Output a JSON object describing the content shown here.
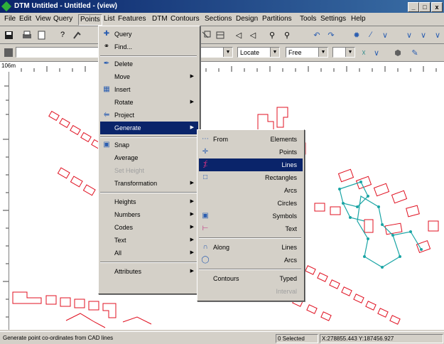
{
  "window": {
    "title": "DTM Untitled - Untitled - (view)",
    "minimize": "_",
    "maximize": "□",
    "close": "x"
  },
  "menubar": [
    "File",
    "Edit",
    "View",
    "Query",
    "Points",
    "List",
    "Features",
    "DTM",
    "Contours",
    "Sections",
    "Design",
    "Partitions",
    "Tools",
    "Settings",
    "Help"
  ],
  "toolbar2": {
    "layer_combo": "",
    "scale_combo": "Locate",
    "mode_combo": "Free"
  },
  "ruler": {
    "scale_label": "106m"
  },
  "points_menu": {
    "items": [
      {
        "label": "Query",
        "icon": "query-icon"
      },
      {
        "label": "Find...",
        "icon": "binoculars-icon"
      },
      {
        "label": "Delete",
        "icon": "delete-icon"
      },
      {
        "label": "Move",
        "submenu": true
      },
      {
        "label": "Insert",
        "icon": "insert-icon"
      },
      {
        "label": "Rotate",
        "submenu": true
      },
      {
        "label": "Project",
        "icon": "project-icon"
      },
      {
        "label": "Generate",
        "submenu": true,
        "highlighted": true
      },
      {
        "label": "Snap",
        "icon": "snap-icon"
      },
      {
        "label": "Average"
      },
      {
        "label": "Set Height",
        "disabled": true
      },
      {
        "label": "Transformation",
        "submenu": true
      },
      {
        "label": "Heights",
        "submenu": true
      },
      {
        "label": "Numbers",
        "submenu": true
      },
      {
        "label": "Codes",
        "submenu": true
      },
      {
        "label": "Text",
        "submenu": true
      },
      {
        "label": "All",
        "submenu": true
      },
      {
        "label": "Attributes",
        "submenu": true
      }
    ]
  },
  "generate_menu": {
    "items": [
      {
        "left": "From",
        "right": "Elements"
      },
      {
        "left": "",
        "right": "Points"
      },
      {
        "left": "",
        "right": "Lines",
        "highlighted": true
      },
      {
        "left": "",
        "right": "Rectangles"
      },
      {
        "left": "",
        "right": "Arcs"
      },
      {
        "left": "",
        "right": "Circles"
      },
      {
        "left": "",
        "right": "Symbols"
      },
      {
        "left": "",
        "right": "Text"
      },
      {
        "left": "Along",
        "right": "Lines"
      },
      {
        "left": "",
        "right": "Arcs"
      },
      {
        "left": "Contours",
        "right": "Typed"
      },
      {
        "left": "",
        "right": "Interval",
        "disabled": true
      }
    ]
  },
  "status": {
    "message": "Generate point co-ordinates from CAD lines",
    "selected": "0 Selected",
    "coords": "X:278855.443 Y:187456.927"
  },
  "colors": {
    "title_bar": "#0a246a",
    "highlight": "#0a246a",
    "cad_red": "#e01020",
    "cad_teal": "#1aa5a5"
  }
}
